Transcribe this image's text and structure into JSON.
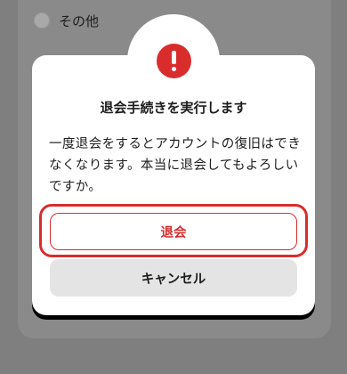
{
  "background": {
    "option_label": "その他"
  },
  "dialog": {
    "icon": "exclamation-icon",
    "title": "退会手続きを実行します",
    "message": "一度退会をするとアカウントの復旧はできなくなります。本当に退会してもよろしいですか。",
    "confirm_label": "退会",
    "cancel_label": "キャンセル"
  },
  "colors": {
    "accent": "#d92d2d",
    "cancel_bg": "#e4e4e4",
    "overlay": "#7f7f7f"
  }
}
